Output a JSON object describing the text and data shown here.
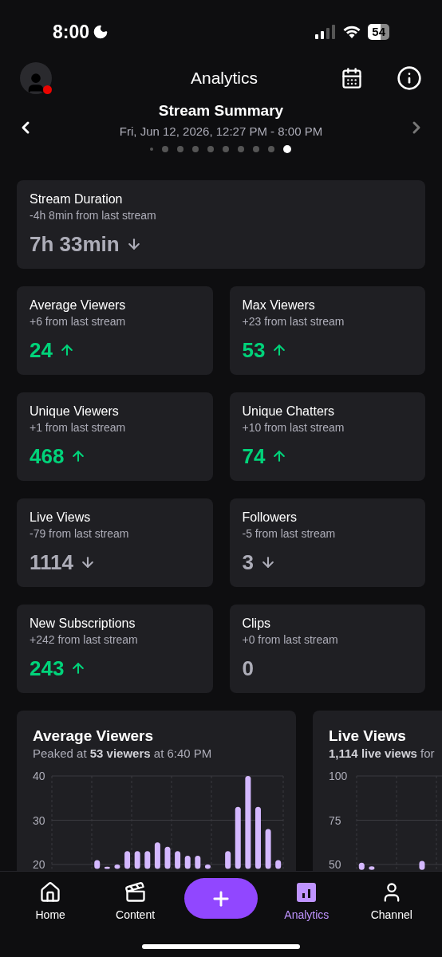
{
  "status_bar": {
    "time": "8:00",
    "battery": "54"
  },
  "header": {
    "title": "Analytics"
  },
  "summary": {
    "title": "Stream Summary",
    "date": "Fri, Jun 12, 2026, 12:27 PM - 8:00 PM",
    "pages": [
      {
        "selected": false
      },
      {
        "selected": false
      },
      {
        "selected": false
      },
      {
        "selected": false
      },
      {
        "selected": false
      },
      {
        "selected": false
      },
      {
        "selected": false
      },
      {
        "selected": false
      },
      {
        "selected": false
      },
      {
        "selected": true
      }
    ]
  },
  "duration": {
    "label": "Stream Duration",
    "comparison": "-4h 8min from last stream",
    "value": "7h 33min",
    "kind": "down"
  },
  "stats": [
    {
      "label": "Average Viewers",
      "comparison": "+6 from last stream",
      "value": "24",
      "kind": "up"
    },
    {
      "label": "Max Viewers",
      "comparison": "+23 from last stream",
      "value": "53",
      "kind": "up"
    },
    {
      "label": "Unique Viewers",
      "comparison": "+1 from last stream",
      "value": "468",
      "kind": "up"
    },
    {
      "label": "Unique Chatters",
      "comparison": "+10 from last stream",
      "value": "74",
      "kind": "up"
    },
    {
      "label": "Live Views",
      "comparison": "-79 from last stream",
      "value": "1114",
      "kind": "down"
    },
    {
      "label": "Followers",
      "comparison": "-5 from last stream",
      "value": "3",
      "kind": "down"
    },
    {
      "label": "New Subscriptions",
      "comparison": "+242 from last stream",
      "value": "243",
      "kind": "up"
    },
    {
      "label": "Clips",
      "comparison": "+0 from last stream",
      "value": "0",
      "kind": "flat"
    }
  ],
  "charts": [
    {
      "title": "Average Viewers",
      "subtitle": "Peaked at **53 viewers** at 6:40 PM",
      "chart_data": {
        "type": "bar",
        "yticks": [
          20,
          30,
          40
        ],
        "ylim": [
          19,
          40
        ],
        "series": [
          {
            "color": "#d4b8ff",
            "values": [
              null,
              null,
              null,
              null,
              21,
              19.5,
              20,
              23,
              23,
              23,
              25,
              24,
              23,
              22,
              22,
              20,
              null,
              23,
              33,
              40,
              33,
              28,
              21
            ]
          }
        ]
      }
    },
    {
      "title": "Live Views",
      "subtitle": "**1,114 live views** for",
      "chart_data": {
        "type": "bar",
        "yticks": [
          50,
          75,
          100
        ],
        "ylim": [
          47,
          100
        ],
        "series": [
          {
            "color": "#d4b8ff",
            "values": [
              51,
              49,
              null,
              null,
              null,
              null,
              52,
              null,
              null,
              null,
              null,
              null,
              null,
              null,
              null,
              null,
              null,
              null,
              null,
              null,
              null,
              null,
              null
            ]
          }
        ]
      }
    }
  ],
  "nav": [
    {
      "kind": "tab",
      "label": "Home",
      "selected": false
    },
    {
      "kind": "tab",
      "label": "Content",
      "selected": false
    },
    {
      "kind": "create"
    },
    {
      "kind": "tab",
      "label": "Analytics",
      "selected": true
    },
    {
      "kind": "tab",
      "label": "Channel",
      "selected": false
    }
  ]
}
